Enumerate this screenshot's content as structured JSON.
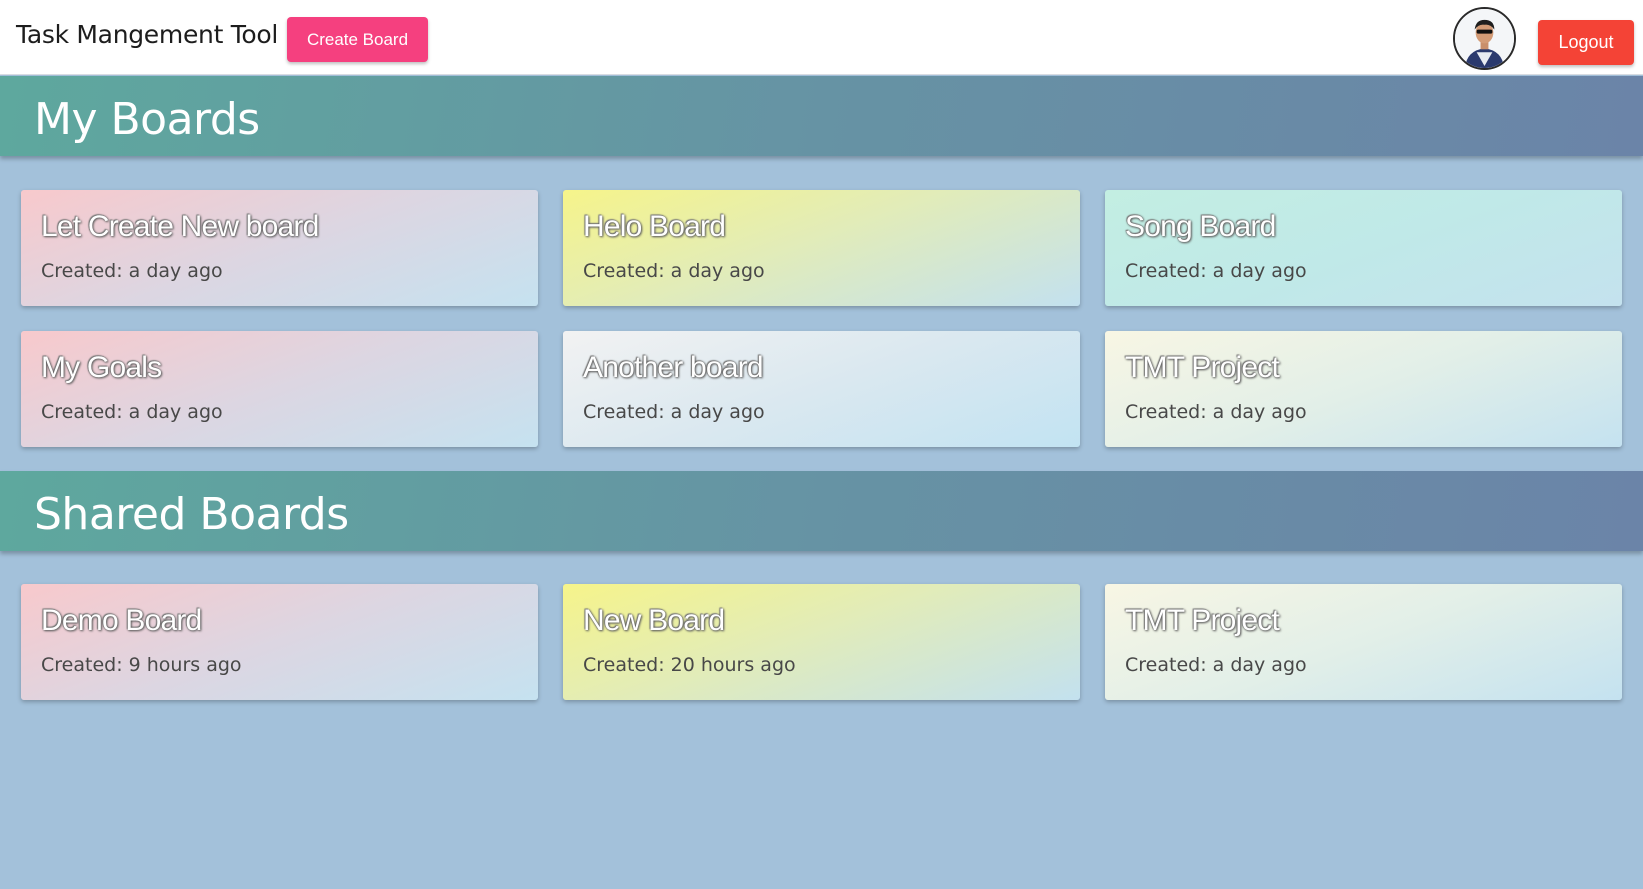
{
  "header": {
    "app_title": "Task Mangement Tool",
    "create_board_label": "Create Board",
    "logout_label": "Logout",
    "avatar_icon": "user-avatar"
  },
  "my_boards": {
    "heading": "My Boards",
    "boards": [
      {
        "title": "Let Create New board",
        "created": "Created: a day ago"
      },
      {
        "title": "Helo Board",
        "created": "Created: a day ago"
      },
      {
        "title": "Song Board",
        "created": "Created: a day ago"
      },
      {
        "title": "My Goals",
        "created": "Created: a day ago"
      },
      {
        "title": "Another board",
        "created": "Created: a day ago"
      },
      {
        "title": "TMT Project",
        "created": "Created: a day ago"
      }
    ]
  },
  "shared_boards": {
    "heading": "Shared Boards",
    "boards": [
      {
        "title": "Demo Board",
        "created": "Created: 9 hours ago"
      },
      {
        "title": "New Board",
        "created": "Created: 20 hours ago"
      },
      {
        "title": "TMT Project",
        "created": "Created: a day ago"
      }
    ]
  },
  "colors": {
    "page_background": "#a3c1da",
    "create_button": "#f5407f",
    "logout_button": "#f44336",
    "section_header_start": "#5ea89e",
    "section_header_end": "#6b84a8"
  }
}
